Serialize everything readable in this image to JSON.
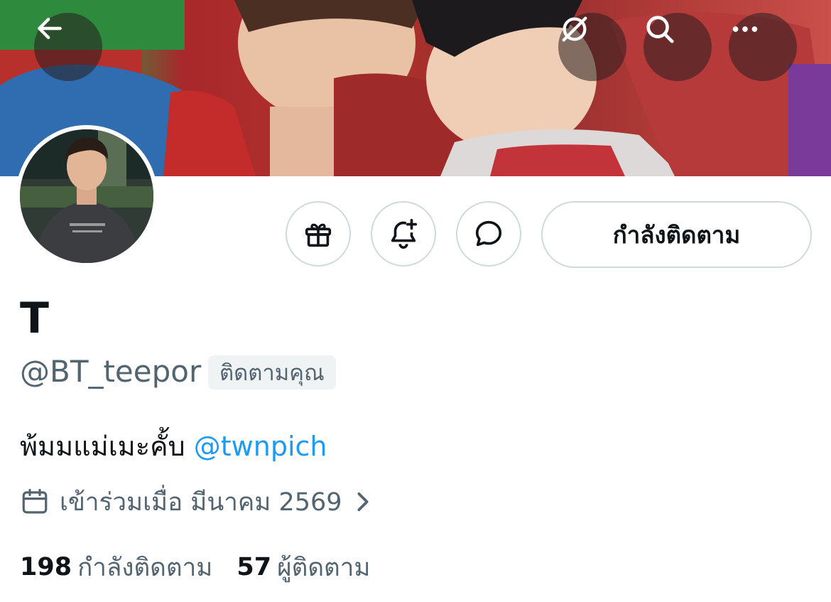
{
  "header": {
    "back_icon": "arrow-left-icon",
    "grok_icon": "slashed-circle-icon",
    "search_icon": "search-icon",
    "more_icon": "more-horizontal-icon"
  },
  "actions": {
    "gift_icon": "gift-icon",
    "notify_icon": "bell-plus-icon",
    "message_icon": "chat-bubble-icon",
    "follow_label": "กำลังติดตาม"
  },
  "profile": {
    "display_name": "T",
    "handle": "@BT_teepor",
    "follows_you_badge": "ติดตามคุณ",
    "bio_text": "พ้มมแม่เมะคั้บ ",
    "bio_mention": "@twnpich",
    "joined": "เข้าร่วมเมื่อ มีนาคม 2569"
  },
  "stats": {
    "following_count": "198",
    "following_label": "กำลังติดตาม",
    "followers_count": "57",
    "followers_label": "ผู้ติดตาม"
  },
  "colors": {
    "accent": "#1d9bf0",
    "secondary_text": "#536471",
    "border": "#cfd9de"
  }
}
